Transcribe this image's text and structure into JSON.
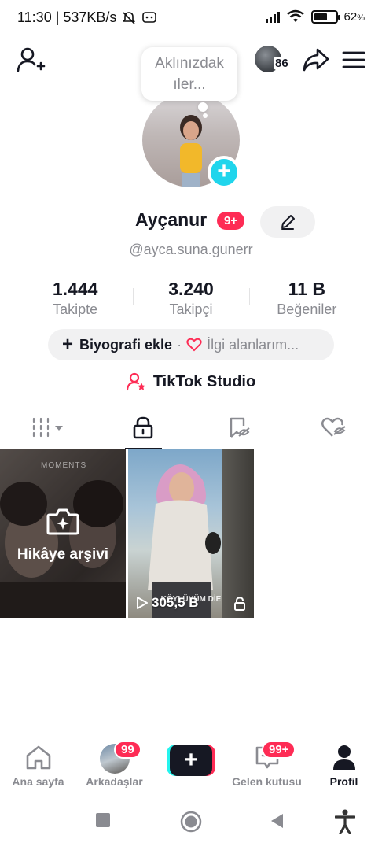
{
  "status_bar": {
    "left_text": "11:30 | 537KB/s",
    "battery": "62",
    "battery_unit": "%"
  },
  "header": {
    "notification_count": "86"
  },
  "profile": {
    "thought_bubble": "Aklınızdak ıler...",
    "thought_line1": "Aklınızdak",
    "thought_line2": "ıler...",
    "name": "Ayçanur",
    "name_badge": "9+",
    "handle": "@ayca.suna.gunerr"
  },
  "stats": [
    {
      "value": "1.444",
      "label": "Takipte"
    },
    {
      "value": "3.240",
      "label": "Takipçi"
    },
    {
      "value": "11 B",
      "label": "Beğeniler"
    }
  ],
  "bio": {
    "add_label": "Biyografi ekle",
    "separator": "·",
    "interests_label": "İlgi alanlarım..."
  },
  "studio": {
    "label": "TikTok Studio"
  },
  "tabs": [
    {
      "icon": "grid-icon",
      "active": false
    },
    {
      "icon": "lock-icon",
      "active": true
    },
    {
      "icon": "repost-bookmark-icon",
      "active": false
    },
    {
      "icon": "liked-heart-icon",
      "active": false
    }
  ],
  "videos": [
    {
      "type": "archive",
      "label": "Hikâye arşivi",
      "overlay": "MOMENTS"
    },
    {
      "type": "video",
      "views": "305,5 B",
      "overlay": "KÖYLÜYÜM DİE",
      "locked": true
    }
  ],
  "bottom_nav": [
    {
      "label": "Ana sayfa",
      "icon": "home-icon",
      "badge": ""
    },
    {
      "label": "Arkadaşlar",
      "icon": "friends-avatar",
      "badge": "99"
    },
    {
      "label": "",
      "icon": "create-plus-icon",
      "badge": ""
    },
    {
      "label": "Gelen kutusu",
      "icon": "inbox-icon",
      "badge": "99+"
    },
    {
      "label": "Profil",
      "icon": "profile-icon",
      "badge": "",
      "active": true
    }
  ],
  "colors": {
    "accent_red": "#fe2c55",
    "accent_cyan": "#20d5ec",
    "text_primary": "#161823",
    "text_secondary": "#8a8b91"
  }
}
